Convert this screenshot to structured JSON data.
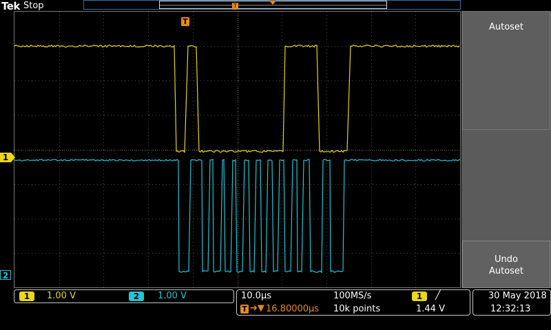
{
  "header": {
    "brand": "Tek",
    "acq_state": "Stop"
  },
  "sidebar": {
    "autoset_label": "Autoset",
    "undo_line1": "Undo",
    "undo_line2": "Autoset"
  },
  "markers": {
    "ch1": "1",
    "ch2": "2",
    "trigger": "T"
  },
  "channels": [
    {
      "id": "1",
      "scale": "1.00 V",
      "color": "#e8d81a"
    },
    {
      "id": "2",
      "scale": "1.00 V",
      "color": "#22c6d6"
    }
  ],
  "timebase": {
    "horizontal_scale": "10.0µs",
    "sample_rate": "100MS/s",
    "trigger_position": "16.80000µs",
    "record_length": "10k points",
    "trigger_source": "1",
    "trigger_slope": "╱",
    "trigger_level": "1.44 V"
  },
  "datetime": {
    "date": "30 May 2018",
    "time": "12:32:13"
  },
  "colors": {
    "ch1": "#e8d81a",
    "ch2": "#22c6d6",
    "trigger": "#e88a1a",
    "grid": "#4a4a4a"
  }
}
